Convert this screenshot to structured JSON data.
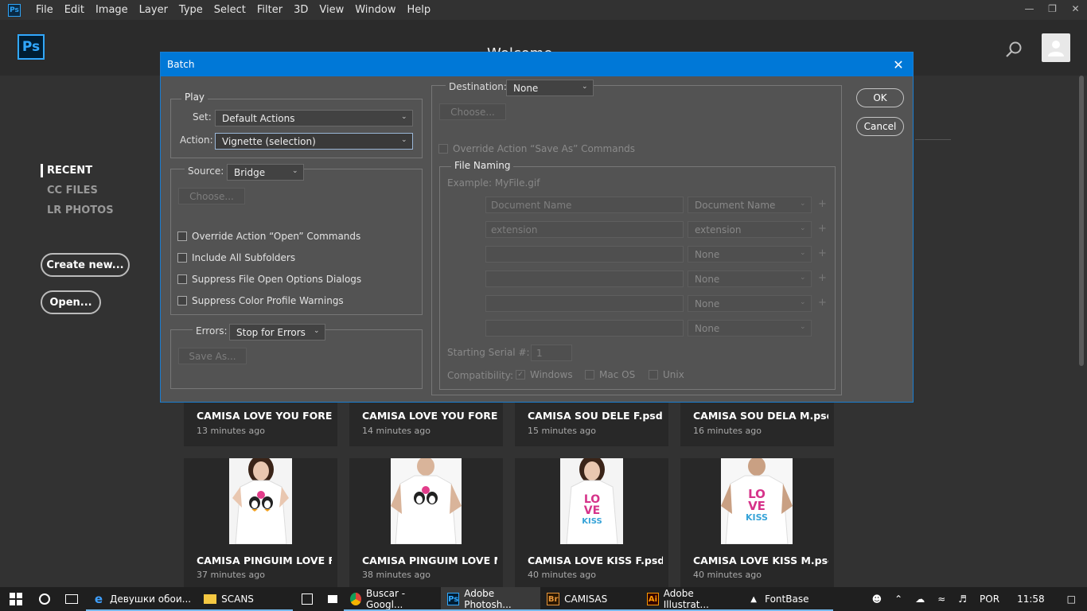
{
  "menubar": {
    "items": [
      "File",
      "Edit",
      "Image",
      "Layer",
      "Type",
      "Select",
      "Filter",
      "3D",
      "View",
      "Window",
      "Help"
    ]
  },
  "header": {
    "logo": "Ps",
    "title": "Welcome"
  },
  "nav": {
    "recent": "RECENT",
    "cc_files": "CC FILES",
    "lr_photos": "LR PHOTOS",
    "create_new": "Create new...",
    "open": "Open..."
  },
  "thumbnails": {
    "row1": [
      {
        "title": "CAMISA LOVE YOU FORE...",
        "time": "13 minutes ago"
      },
      {
        "title": "CAMISA LOVE YOU FORE...",
        "time": "14 minutes ago"
      },
      {
        "title": "CAMISA SOU DELE F.psd",
        "time": "15 minutes ago"
      },
      {
        "title": "CAMISA SOU DELA M.psd",
        "time": "16 minutes ago"
      }
    ],
    "row2": [
      {
        "title": "CAMISA PINGUIM LOVE F...",
        "time": "37 minutes ago",
        "print": "penguins"
      },
      {
        "title": "CAMISA PINGUIM LOVE M...",
        "time": "38 minutes ago",
        "print": "penguins"
      },
      {
        "title": "CAMISA LOVE KISS F.psd",
        "time": "40 minutes ago",
        "print": "love-kiss"
      },
      {
        "title": "CAMISA LOVE KISS M.psd",
        "time": "40 minutes ago",
        "print": "love-kiss"
      }
    ]
  },
  "dialog": {
    "title": "Batch",
    "play": {
      "legend": "Play",
      "set_label": "Set:",
      "set_value": "Default Actions",
      "action_label": "Action:",
      "action_value": "Vignette (selection)"
    },
    "source": {
      "label": "Source:",
      "value": "Bridge",
      "choose": "Choose...",
      "checks": [
        {
          "label": "Override Action “Open” Commands",
          "checked": false
        },
        {
          "label": "Include All Subfolders",
          "checked": false
        },
        {
          "label": "Suppress File Open Options Dialogs",
          "checked": false
        },
        {
          "label": "Suppress Color Profile Warnings",
          "checked": false
        }
      ]
    },
    "errors": {
      "label": "Errors:",
      "value": "Stop for Errors",
      "save_as": "Save As..."
    },
    "destination": {
      "label": "Destination:",
      "value": "None",
      "choose": "Choose...",
      "override_save": "Override Action “Save As” Commands"
    },
    "file_naming": {
      "legend": "File Naming",
      "example": "Example: MyFile.gif",
      "rows": [
        {
          "field": "Document Name",
          "select": "Document Name",
          "plus": "+"
        },
        {
          "field": "extension",
          "select": "extension",
          "plus": "+"
        },
        {
          "field": "",
          "select": "None",
          "plus": "+"
        },
        {
          "field": "",
          "select": "None",
          "plus": "+"
        },
        {
          "field": "",
          "select": "None",
          "plus": "+"
        },
        {
          "field": "",
          "select": "None",
          "plus": ""
        }
      ],
      "serial_label": "Starting Serial #:",
      "serial_value": "1",
      "compat_label": "Compatibility:",
      "compat": [
        {
          "label": "Windows",
          "checked": true
        },
        {
          "label": "Mac OS",
          "checked": false
        },
        {
          "label": "Unix",
          "checked": false
        }
      ]
    },
    "ok": "OK",
    "cancel": "Cancel"
  },
  "taskbar": {
    "apps": [
      {
        "label": "Девушки обои...",
        "icon": "edge-icon"
      },
      {
        "label": "SCANS",
        "icon": "folder-icon"
      },
      {
        "label": "Buscar - Googl...",
        "icon": "chrome-icon"
      },
      {
        "label": "Adobe Photosh...",
        "icon": "photoshop-icon"
      },
      {
        "label": "CAMISAS",
        "icon": "bridge-icon"
      },
      {
        "label": "Adobe Illustrat...",
        "icon": "illustrator-icon"
      },
      {
        "label": "FontBase",
        "icon": "fontbase-icon"
      }
    ],
    "language": "POR",
    "time": "11:58"
  }
}
